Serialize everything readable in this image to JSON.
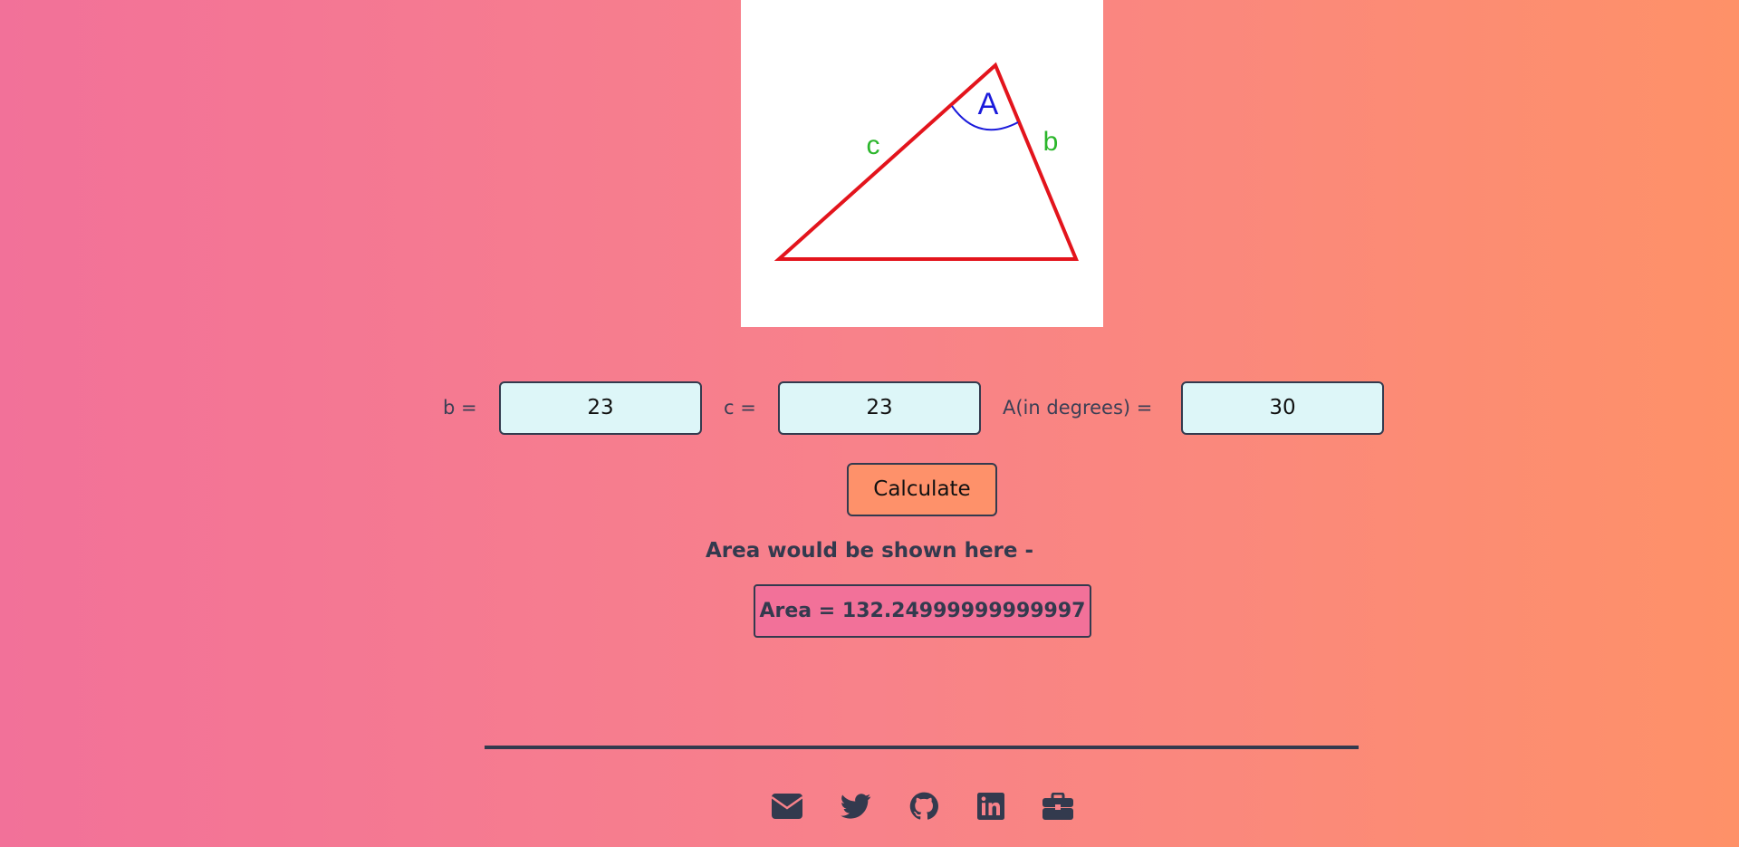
{
  "diagram": {
    "vertex_label": "A",
    "side_b_label": "b",
    "side_c_label": "c",
    "triangle_color": "#E3141C",
    "angle_color": "#1A1ADB",
    "side_color": "#2BB62B"
  },
  "form": {
    "b_label": "b =",
    "b_value": "23",
    "c_label": "c =",
    "c_value": "23",
    "a_label": "A(in degrees) =",
    "a_value": "30"
  },
  "calculate_label": "Calculate",
  "hint_text": "Area would be shown here -",
  "result_text": "Area = 132.24999999999997",
  "footer": {
    "icons": [
      "mail-icon",
      "twitter-icon",
      "github-icon",
      "linkedin-icon",
      "briefcase-icon"
    ]
  },
  "colors": {
    "gradient_start": "#F27199",
    "gradient_end": "#FE9168",
    "text_dark": "#333A4E",
    "input_bg": "#DDF6F8",
    "button_bg": "#FE916A",
    "result_bg": "#F27199"
  }
}
